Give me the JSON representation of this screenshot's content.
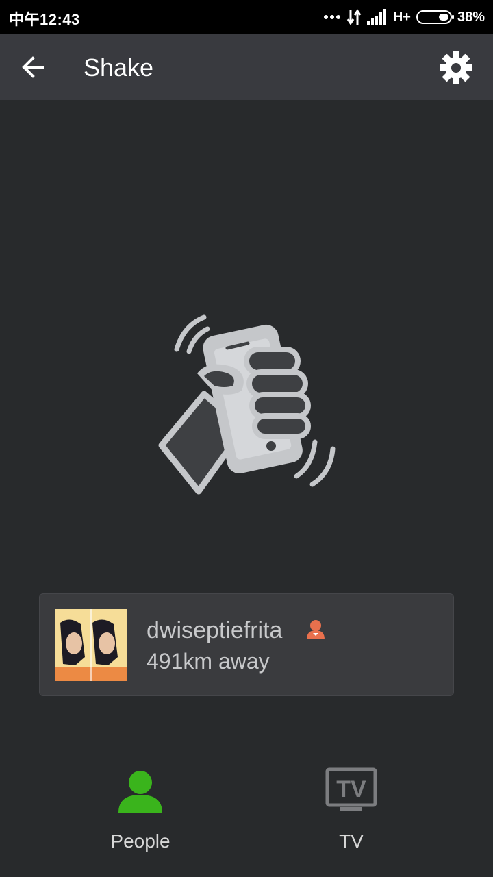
{
  "status_bar": {
    "time": "中午12:43",
    "network": "H+",
    "battery": "38%"
  },
  "header": {
    "title": "Shake",
    "back_icon": "arrow-left-icon",
    "settings_icon": "gear-icon"
  },
  "result": {
    "username": "dwiseptiefrita",
    "distance": "491km away",
    "gender_icon": "female-icon"
  },
  "tabs": [
    {
      "label": "People",
      "icon": "person-icon",
      "active": true,
      "color": "#3ab41c"
    },
    {
      "label": "TV",
      "icon": "tv-icon",
      "active": false,
      "color": "#7c7d80"
    }
  ],
  "colors": {
    "background": "#282a2c",
    "header": "#393a3f",
    "accent_green": "#3ab41c",
    "female_badge": "#e8704d"
  }
}
